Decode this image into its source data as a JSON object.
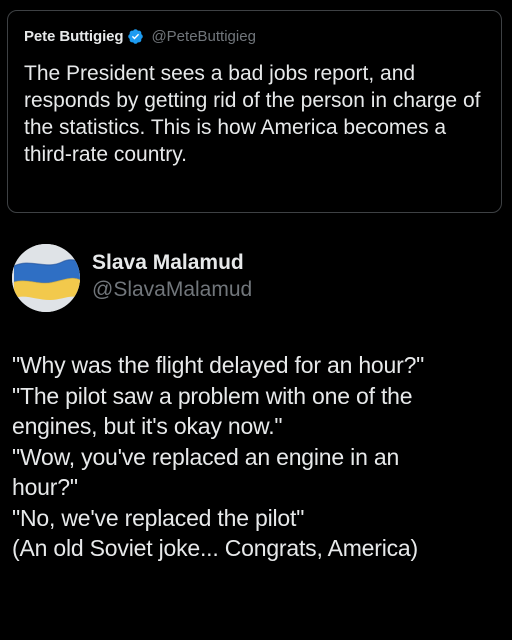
{
  "quoted_tweet": {
    "name": "Pete Buttigieg",
    "handle": "@PeteButtigieg",
    "verified": true,
    "text": "The President sees a bad jobs report, and responds by getting rid of the person in charge of the statistics. This is how America becomes a third-rate country."
  },
  "tweet": {
    "author_name": "Slava Malamud",
    "author_handle": "@SlavaMalamud",
    "avatar_icon": "ukraine-flag-avatar",
    "lines": [
      "\"Why was the flight delayed for an hour?\"",
      "\"The pilot saw a problem with one of the",
      "engines, but it's okay now.\"",
      "\"Wow, you've replaced an engine in an",
      "hour?\"",
      "\"No, we've replaced the pilot\"",
      "(An old Soviet joke... Congrats, America)"
    ]
  },
  "colors": {
    "background": "#000000",
    "text_primary": "#e7e9ea",
    "text_secondary": "#71767b",
    "border": "#3e4144",
    "verified_badge": "#1d9bf0",
    "flag_blue": "#2f6fc4",
    "flag_yellow": "#f2c94c"
  }
}
